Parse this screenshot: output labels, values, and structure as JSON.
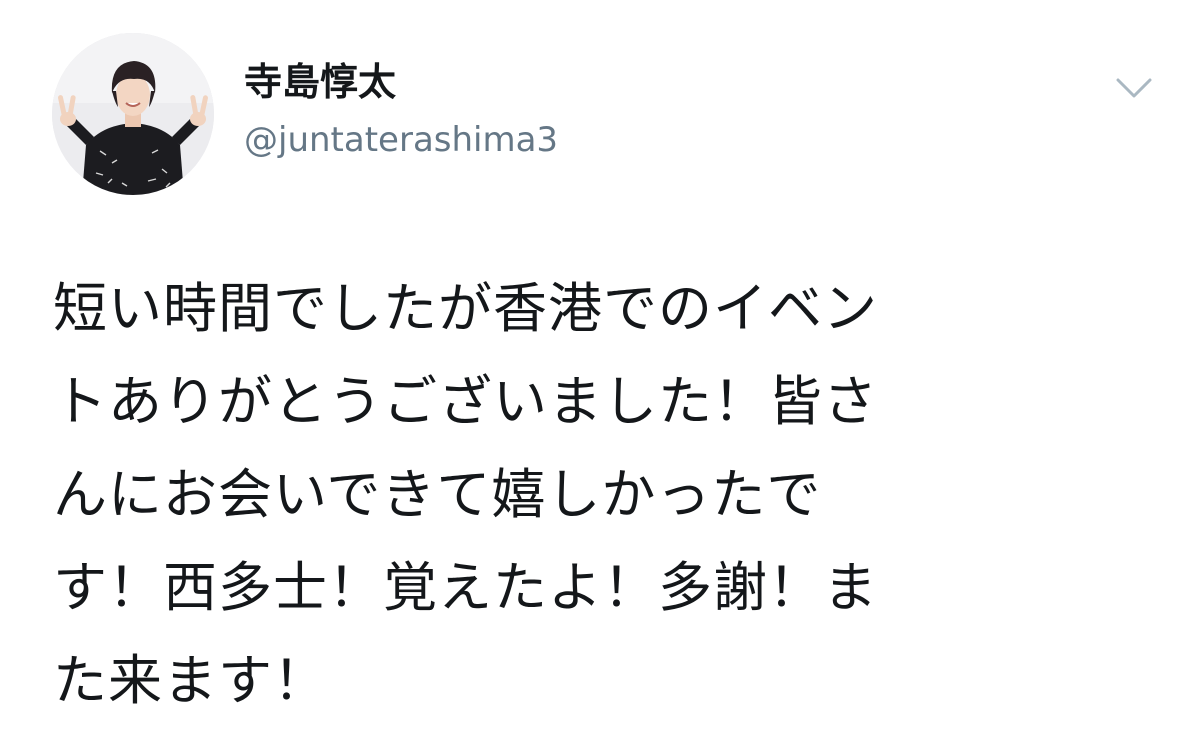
{
  "user": {
    "display_name": "寺島惇太",
    "handle": "@juntaterashima3",
    "avatar_icon": "avatar-photo"
  },
  "menu": {
    "icon": "chevron-down-icon"
  },
  "tweet": {
    "lines": [
      "短い時間でしたが香港でのイベン",
      "トありがとうございました！皆さ",
      "んにお会いできて嬉しかったで",
      "す！西多士！覚えたよ！多謝！ま",
      "た来ます！"
    ]
  },
  "colors": {
    "text": "#14171a",
    "secondary": "#657786",
    "caret": "#aab8c2",
    "background": "#ffffff"
  }
}
